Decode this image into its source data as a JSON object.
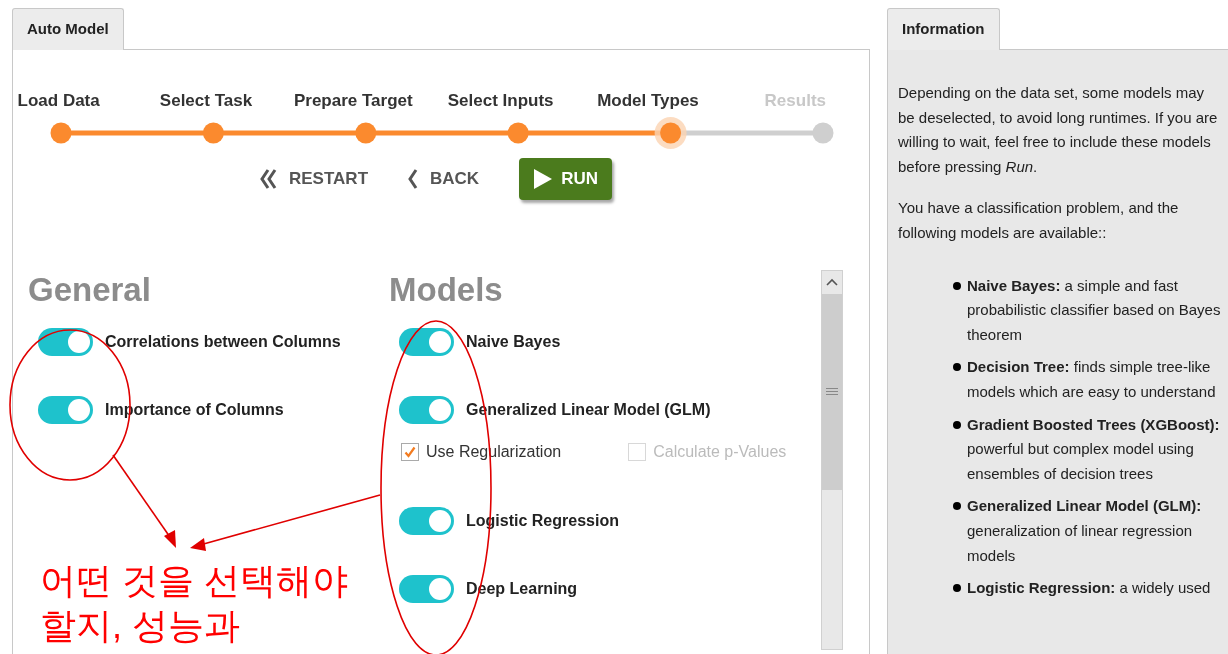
{
  "left_tab": {
    "label": "Auto Model",
    "selected": true
  },
  "steps": [
    {
      "label": "Load Data",
      "reached": true,
      "selected": false
    },
    {
      "label": "Select Task",
      "reached": true,
      "selected": false
    },
    {
      "label": "Prepare Target",
      "reached": true,
      "selected": false
    },
    {
      "label": "Select Inputs",
      "reached": true,
      "selected": false
    },
    {
      "label": "Model Types",
      "reached": true,
      "selected": true
    },
    {
      "label": "Results",
      "reached": false,
      "selected": false
    }
  ],
  "buttons": [
    {
      "kind": "restart",
      "label": "RESTART"
    },
    {
      "kind": "back",
      "label": "BACK"
    },
    {
      "kind": "run",
      "label": "RUN"
    }
  ],
  "general": {
    "title": "General",
    "items": [
      {
        "label": "Correlations between Columns",
        "on": true
      },
      {
        "label": "Importance of Columns",
        "on": true
      }
    ]
  },
  "models": {
    "title": "Models",
    "items": [
      {
        "label": "Naive Bayes",
        "on": true
      },
      {
        "label": "Generalized Linear Model (GLM)",
        "on": true,
        "options": [
          {
            "label": "Use Regularization",
            "checked": true,
            "disabled": false
          },
          {
            "label": "Calculate p-Values",
            "checked": false,
            "disabled": true
          }
        ]
      },
      {
        "label": "Logistic Regression",
        "on": true
      },
      {
        "label": "Deep Learning",
        "on": true
      }
    ]
  },
  "right_tab": {
    "label": "Information",
    "selected": true
  },
  "info": {
    "paragraphs": [
      "Depending on the data set, some models may be deselected, to avoid long runtimes. If you are willing to wait, feel free to include these models before pressing *Run*.",
      "You have a classification problem, and the following models are available::"
    ],
    "models": [
      "**Naive Bayes:** a simple and fast probabilistic classifier based on Bayes theorem",
      "**Decision Tree:** finds simple tree-like models which are easy to understand",
      "**Gradient Boosted Trees (XGBoost):** powerful but complex model using ensembles of decision trees",
      "**Generalized Linear Model (GLM):** generalization of linear regression models",
      "**Logistic Regression:** a widely used"
    ]
  },
  "annotation": {
    "text": "어떤 것을 선택해야 할지, 성능과"
  }
}
